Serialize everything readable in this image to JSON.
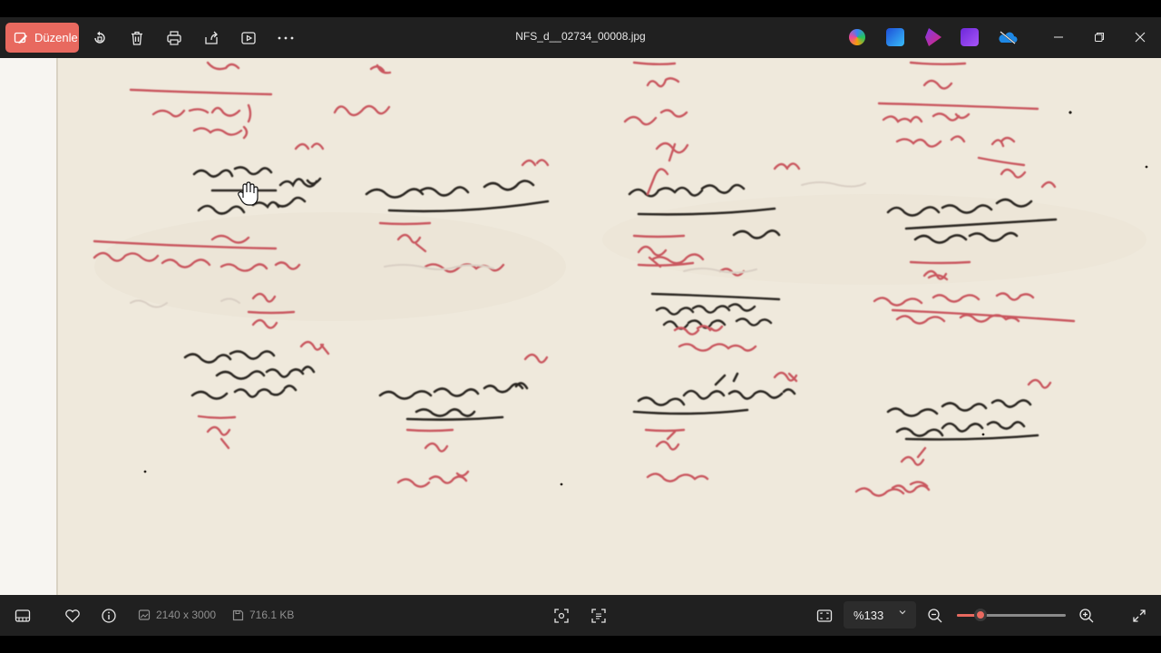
{
  "window": {
    "title": "NFS_d__02734_00008.jpg",
    "edit_label": "Düzenle"
  },
  "toolbar": {
    "icons": [
      "rotate-icon",
      "delete-icon",
      "print-icon",
      "share-icon",
      "slideshow-icon",
      "more-icon"
    ]
  },
  "apps": [
    "copilot-icon",
    "photo-editor-icon",
    "clipchamp-icon",
    "designer-icon",
    "onedrive-icon"
  ],
  "image_info": {
    "dimensions": "2140 x 3000",
    "file_size": "716.1 KB"
  },
  "zoom": {
    "label": "%133",
    "level": 0.22
  },
  "colors": {
    "accent": "#e8695f",
    "chrome": "#202020",
    "paper": "#efe9dc",
    "ink_black": "#2b2620",
    "ink_red": "#c9575e"
  }
}
